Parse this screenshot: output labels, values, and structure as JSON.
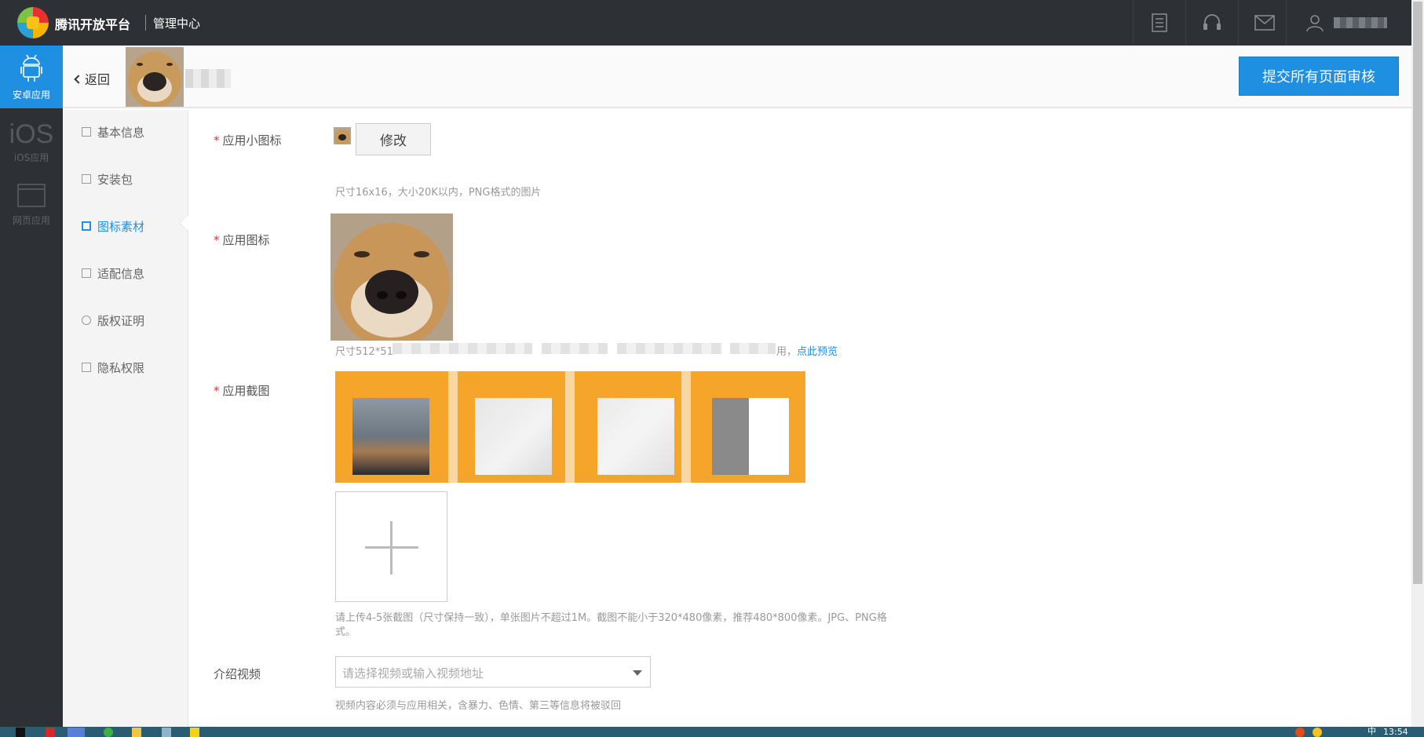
{
  "topbar": {
    "brand": "腾讯开放平台",
    "subtitle": "管理中心",
    "icons": [
      "document-icon",
      "headset-icon",
      "mail-icon",
      "user-icon"
    ]
  },
  "platforms": [
    {
      "label": "安卓应用",
      "icon": "android-icon",
      "active": true
    },
    {
      "label": "iOS应用",
      "icon": "ios-icon",
      "active": false
    },
    {
      "label": "网页应用",
      "icon": "webpage-icon",
      "active": false
    }
  ],
  "ios_glyph": "iOS",
  "header": {
    "back_label": "返回",
    "submit_label": "提交所有页面审核"
  },
  "subnav": [
    {
      "label": "基本信息",
      "active": false
    },
    {
      "label": "安装包",
      "active": false
    },
    {
      "label": "图标素材",
      "active": true
    },
    {
      "label": "适配信息",
      "active": false
    },
    {
      "label": "版权证明",
      "active": false
    },
    {
      "label": "隐私权限",
      "active": false
    }
  ],
  "form": {
    "required_mark": "*",
    "small_icon_label": "应用小图标",
    "modify_label": "修改",
    "small_icon_hint": "尺寸16x16，大小20K以内，PNG格式的图片",
    "icon_label": "应用图标",
    "icon_hint_prefix": "尺寸512*51",
    "icon_hint_end": "用，",
    "preview_link": "点此预览",
    "screenshots_label": "应用截图",
    "screenshots_hint": "请上传4-5张截图（尺寸保持一致），单张图片不超过1M。截图不能小于320*480像素，推荐480*800像素。JPG、PNG格式。",
    "video_label": "介绍视频",
    "video_placeholder": "请选择视频或输入视频地址",
    "video_hint": "视频内容必须与应用相关，含暴力、色情、第三等信息将被驳回"
  },
  "taskbar": {
    "time": "13:54",
    "ime": "中"
  },
  "colors": {
    "accent": "#1e8fe1",
    "topbar": "#2d3035",
    "required": "#e8312e",
    "screenshot_frame": "#f4a52a"
  }
}
